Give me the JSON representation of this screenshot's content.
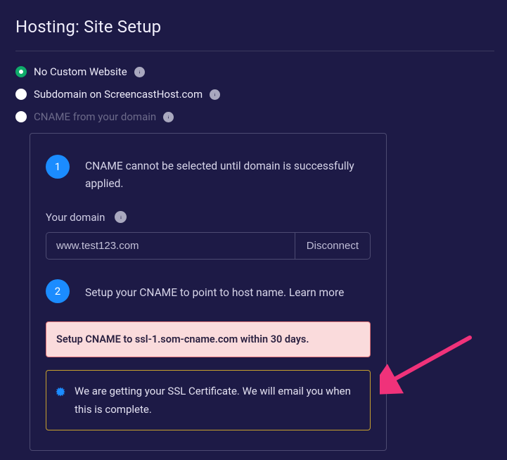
{
  "page_title": "Hosting: Site Setup",
  "options": {
    "no_custom": "No Custom Website",
    "subdomain": "Subdomain on ScreencastHost.com",
    "cname": "CNAME from your domain"
  },
  "panel": {
    "step1": {
      "num": "1",
      "text": "CNAME cannot be selected until domain is successfully applied."
    },
    "domain_label": "Your domain",
    "domain_value": "www.test123.com",
    "disconnect_label": "Disconnect",
    "step2": {
      "num": "2",
      "text": "Setup your CNAME to point to host name. Learn more"
    },
    "alert_setup": "Setup CNAME to ssl-1.som-cname.com within 30 days.",
    "alert_ssl": "We are getting your SSL Certificate. We will email you when this is complete."
  }
}
